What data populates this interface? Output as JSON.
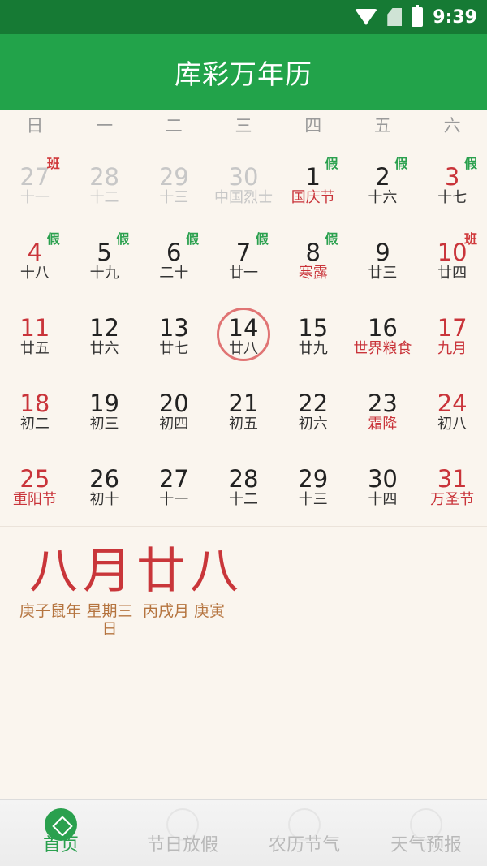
{
  "status_bar": {
    "time": "9:39"
  },
  "app": {
    "title": "库彩万年历"
  },
  "weekdays": [
    "日",
    "一",
    "二",
    "三",
    "四",
    "五",
    "六"
  ],
  "calendar": {
    "days": [
      {
        "num": "27",
        "lunar": "十一",
        "badge": "班"
      },
      {
        "num": "28",
        "lunar": "十二",
        "badge": ""
      },
      {
        "num": "29",
        "lunar": "十三",
        "badge": ""
      },
      {
        "num": "30",
        "lunar": "中国烈士",
        "badge": ""
      },
      {
        "num": "1",
        "lunar": "国庆节",
        "badge": "假"
      },
      {
        "num": "2",
        "lunar": "十六",
        "badge": "假"
      },
      {
        "num": "3",
        "lunar": "十七",
        "badge": "假"
      },
      {
        "num": "4",
        "lunar": "十八",
        "badge": "假"
      },
      {
        "num": "5",
        "lunar": "十九",
        "badge": "假"
      },
      {
        "num": "6",
        "lunar": "二十",
        "badge": "假"
      },
      {
        "num": "7",
        "lunar": "廿一",
        "badge": "假"
      },
      {
        "num": "8",
        "lunar": "寒露",
        "badge": "假"
      },
      {
        "num": "9",
        "lunar": "廿三",
        "badge": ""
      },
      {
        "num": "10",
        "lunar": "廿四",
        "badge": "班"
      },
      {
        "num": "11",
        "lunar": "廿五",
        "badge": ""
      },
      {
        "num": "12",
        "lunar": "廿六",
        "badge": ""
      },
      {
        "num": "13",
        "lunar": "廿七",
        "badge": ""
      },
      {
        "num": "14",
        "lunar": "廿八",
        "badge": ""
      },
      {
        "num": "15",
        "lunar": "廿九",
        "badge": ""
      },
      {
        "num": "16",
        "lunar": "世界粮食",
        "badge": ""
      },
      {
        "num": "17",
        "lunar": "九月",
        "badge": ""
      },
      {
        "num": "18",
        "lunar": "初二",
        "badge": ""
      },
      {
        "num": "19",
        "lunar": "初三",
        "badge": ""
      },
      {
        "num": "20",
        "lunar": "初四",
        "badge": ""
      },
      {
        "num": "21",
        "lunar": "初五",
        "badge": ""
      },
      {
        "num": "22",
        "lunar": "初六",
        "badge": ""
      },
      {
        "num": "23",
        "lunar": "霜降",
        "badge": ""
      },
      {
        "num": "24",
        "lunar": "初八",
        "badge": ""
      },
      {
        "num": "25",
        "lunar": "重阳节",
        "badge": ""
      },
      {
        "num": "26",
        "lunar": "初十",
        "badge": ""
      },
      {
        "num": "27",
        "lunar": "十一",
        "badge": ""
      },
      {
        "num": "28",
        "lunar": "十二",
        "badge": ""
      },
      {
        "num": "29",
        "lunar": "十三",
        "badge": ""
      },
      {
        "num": "30",
        "lunar": "十四",
        "badge": ""
      },
      {
        "num": "31",
        "lunar": "万圣节",
        "badge": ""
      }
    ]
  },
  "detail": {
    "lunar_date": "八月廿八",
    "year_ganzhi": "庚子鼠年",
    "weekday": "星期三",
    "weekday_suffix": "日",
    "month_ganzhi": "丙戌月",
    "day_ganzhi": "庚寅"
  },
  "tabs": [
    {
      "label": "首页"
    },
    {
      "label": "节日放假"
    },
    {
      "label": "农历节气"
    },
    {
      "label": "天气预报"
    }
  ],
  "colors": {
    "primary_green": "#22a34a",
    "status_bar": "#167a34",
    "holiday_red": "#c9343a",
    "background": "#faf5ee"
  }
}
